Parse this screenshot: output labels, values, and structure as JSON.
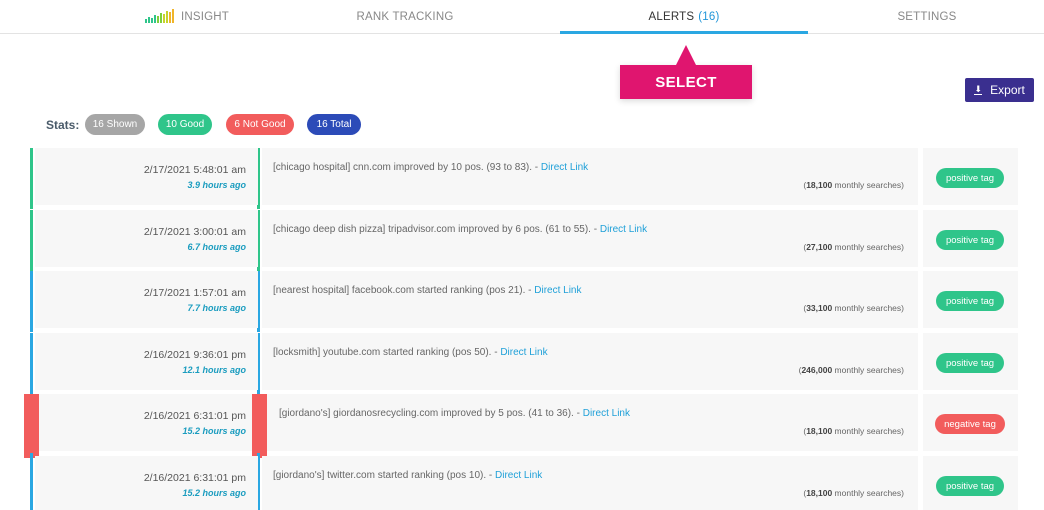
{
  "nav": {
    "tabs": [
      {
        "label": "INSIGHT"
      },
      {
        "label": "RANK TRACKING"
      },
      {
        "label": "ALERTS",
        "count": "(16)"
      },
      {
        "label": "SETTINGS"
      }
    ],
    "active_tab": "ALERTS"
  },
  "tooltip": {
    "label": "SELECT"
  },
  "export": {
    "label": "Export"
  },
  "stats": {
    "label": "Stats:",
    "shown": "16 Shown",
    "good": "10 Good",
    "not_good": "6 Not Good",
    "total": "16 Total"
  },
  "colors": {
    "green": "#2fc58a",
    "blue": "#2aa7e2",
    "red": "#f25c5c",
    "magenta": "#e0156f",
    "indigo": "#3a2f8f",
    "navy": "#2c4bb8",
    "grey": "#a6a6a6"
  },
  "alerts": [
    {
      "date": "2/17/2021 5:48:01 am",
      "ago": "3.9 hours ago",
      "message": "[chicago hospital] cnn.com improved by 10 pos. (93 to 83). - ",
      "link": "Direct Link",
      "searches_count": "18,100",
      "searches_suffix": " monthly searches)",
      "tag": "positive tag",
      "line_color": "green"
    },
    {
      "date": "2/17/2021 3:00:01 am",
      "ago": "6.7 hours ago",
      "message": "[chicago deep dish pizza] tripadvisor.com improved by 6 pos. (61 to 55). - ",
      "link": "Direct Link",
      "searches_count": "27,100",
      "searches_suffix": " monthly searches)",
      "tag": "positive tag",
      "line_color": "green"
    },
    {
      "date": "2/17/2021 1:57:01 am",
      "ago": "7.7 hours ago",
      "message": "[nearest hospital] facebook.com started ranking (pos 21). - ",
      "link": "Direct Link",
      "searches_count": "33,100",
      "searches_suffix": " monthly searches)",
      "tag": "positive tag",
      "line_color": "blue"
    },
    {
      "date": "2/16/2021 9:36:01 pm",
      "ago": "12.1 hours ago",
      "message": "[locksmith] youtube.com started ranking (pos 50). - ",
      "link": "Direct Link",
      "searches_count": "246,000",
      "searches_suffix": " monthly searches)",
      "tag": "positive tag",
      "line_color": "blue"
    },
    {
      "date": "2/16/2021 6:31:01 pm",
      "ago": "15.2 hours ago",
      "message": "[giordano's] giordanosrecycling.com improved by 5 pos. (41 to 36). - ",
      "link": "Direct Link",
      "searches_count": "18,100",
      "searches_suffix": " monthly searches)",
      "tag": "negative tag",
      "line_color": "red"
    },
    {
      "date": "2/16/2021 6:31:01 pm",
      "ago": "15.2 hours ago",
      "message": "[giordano's] twitter.com started ranking (pos 10). - ",
      "link": "Direct Link",
      "searches_count": "18,100",
      "searches_suffix": " monthly searches)",
      "tag": "positive tag",
      "line_color": "blue"
    }
  ]
}
